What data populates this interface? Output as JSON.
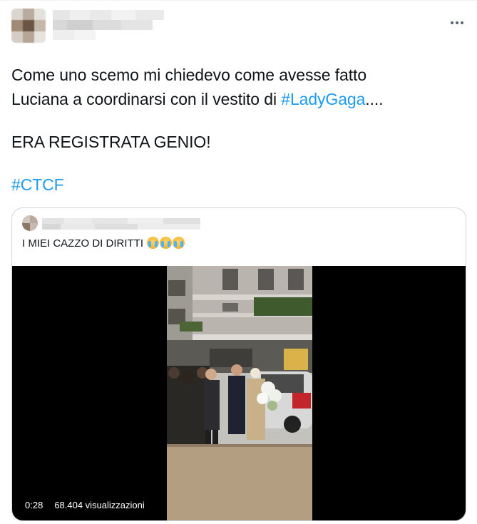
{
  "tweet": {
    "author": {
      "avatar_icon": "blurred-avatar",
      "name_blurred": true
    },
    "more_icon": "more-dots-icon",
    "line1": "Come uno scemo mi chiedevo come avesse fatto",
    "line2_before": "Luciana a coordinarsi con il vestito di ",
    "line2_hashtag": "#LadyGaga",
    "line2_after": "....",
    "line3": "ERA REGISTRATA GENIO!",
    "line4_hashtag": "#CTCF",
    "hashtag_color": "#1d9bf0"
  },
  "quoted_tweet": {
    "author": {
      "avatar_icon": "blurred-avatar",
      "name_blurred": true
    },
    "text": "I MIEI CAZZO DI DIRITTI",
    "emojis": [
      "crying-face-emoji",
      "crying-face-emoji",
      "crying-face-emoji"
    ],
    "video": {
      "duration": "0:28",
      "views": "68.404 visualizzazioni"
    }
  }
}
